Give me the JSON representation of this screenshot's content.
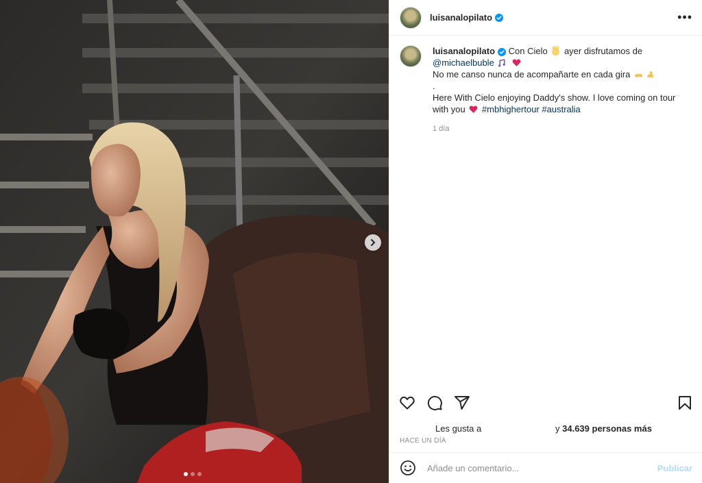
{
  "post": {
    "username": "luisanalopilato",
    "more_label": "•••",
    "next_label": "›"
  },
  "caption": {
    "username": "luisanalopilato",
    "line1_text": " Con Cielo ",
    "line1_tail": " ayer disfrutamos de",
    "mention": "@michaelbuble",
    "line3": "No me canso nunca de acompañarte en cada gira ",
    "line4": ".",
    "line5": "Here With Cielo enjoying Daddy's show. I love coming on tour with you ",
    "hashtag1": "#mbhighertour",
    "hashtag2": "#australia",
    "age": "1 día"
  },
  "likes": {
    "prefix": "Les gusta a",
    "connector": "y ",
    "count_text": "34.639 personas más"
  },
  "posted": "HACE UN DÍA",
  "comment": {
    "placeholder": "Añade un comentario...",
    "publish": "Publicar"
  },
  "carousel": {
    "count": 3,
    "active": 1
  },
  "icons": {
    "verified": "verified-badge-icon",
    "heart": "heart-icon",
    "comment": "comment-icon",
    "share": "share-icon",
    "save": "bookmark-icon",
    "emoji": "emoji-smile-icon"
  },
  "colors": {
    "verified": "#0095f6",
    "link": "#00376b",
    "heart_emoji": "#e0245e",
    "publish": "#b3dbff"
  }
}
